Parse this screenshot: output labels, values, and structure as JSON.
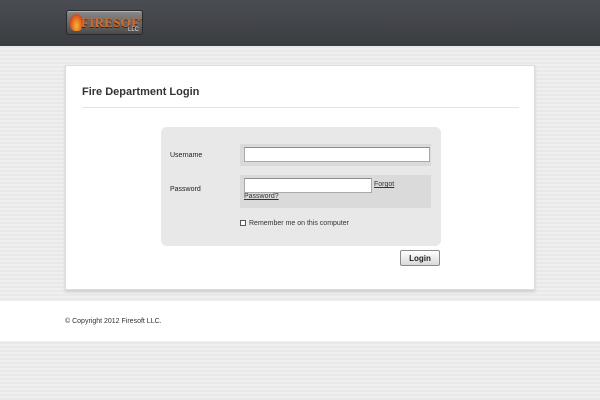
{
  "header": {
    "logo_text": "FIRESOFT",
    "logo_suffix": "LLC"
  },
  "page": {
    "title": "Fire Department Login"
  },
  "form": {
    "username_label": "Username",
    "username_value": "",
    "password_label": "Password",
    "password_value": "",
    "forgot_password_link": "Forgot Password?",
    "remember_label": "Remember me on this computer",
    "remember_checked": false,
    "login_button": "Login"
  },
  "footer": {
    "copyright": "© Copyright 2012 Firesoft LLC."
  },
  "colors": {
    "header_bg": "#3f4246",
    "panel_bg": "#ffffff",
    "form_bg": "#e8e8e8",
    "field_row_bg": "#dadada"
  }
}
